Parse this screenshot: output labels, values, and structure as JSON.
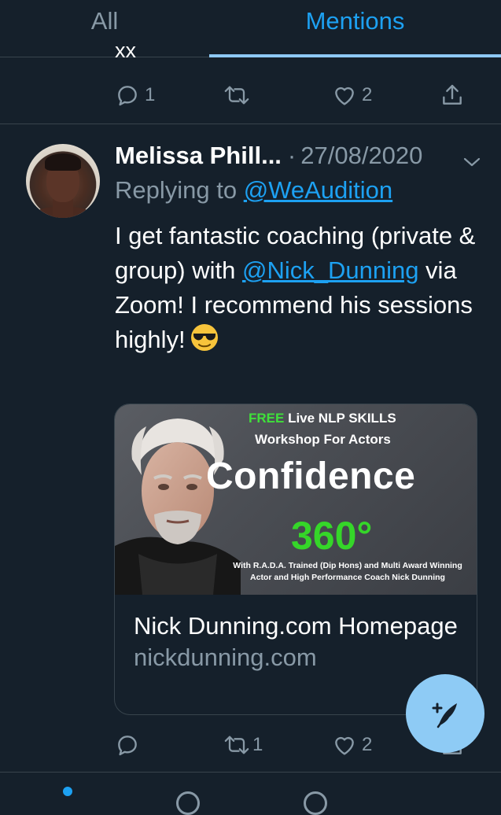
{
  "tabs": {
    "all_label": "All",
    "mentions_label": "Mentions",
    "active": "Mentions"
  },
  "previous_tweet": {
    "tail_text": "xx",
    "reply_count": "1",
    "retweet_count": "",
    "like_count": "2"
  },
  "tweet": {
    "author_name": "Melissa Phill...",
    "separator": "·",
    "date": "27/08/2020",
    "replying_prefix": "Replying to ",
    "replying_handle": "@WeAudition",
    "text_part1": "I get fantastic coaching (private & group) with ",
    "text_mention": "@Nick_Dunning",
    "text_part2": " via Zoom! I recommend his sessions highly!",
    "emoji": "smiling-face-with-sunglasses",
    "reply_count": "",
    "retweet_count": "1",
    "like_count": "2"
  },
  "card": {
    "image": {
      "free_word": "FREE",
      "free_rest": " Live NLP SKILLS",
      "workshop_line": "Workshop For Actors",
      "headline": "Confidence",
      "degree": "360°",
      "credit": "With R.A.D.A. Trained (Dip Hons) and Multi Award Winning Actor and High Performance Coach Nick Dunning"
    },
    "title": "Nick Dunning.com Homepage",
    "domain": "nickdunning.com"
  },
  "colors": {
    "background": "#15202b",
    "accent": "#1da1f2",
    "muted": "#8899a6",
    "divider": "#38444d",
    "fab": "#8ecbf5"
  },
  "icons": {
    "reply": "reply-icon",
    "retweet": "retweet-icon",
    "like": "heart-icon",
    "share": "share-icon",
    "caret": "chevron-down-icon",
    "compose": "compose-tweet-icon"
  }
}
